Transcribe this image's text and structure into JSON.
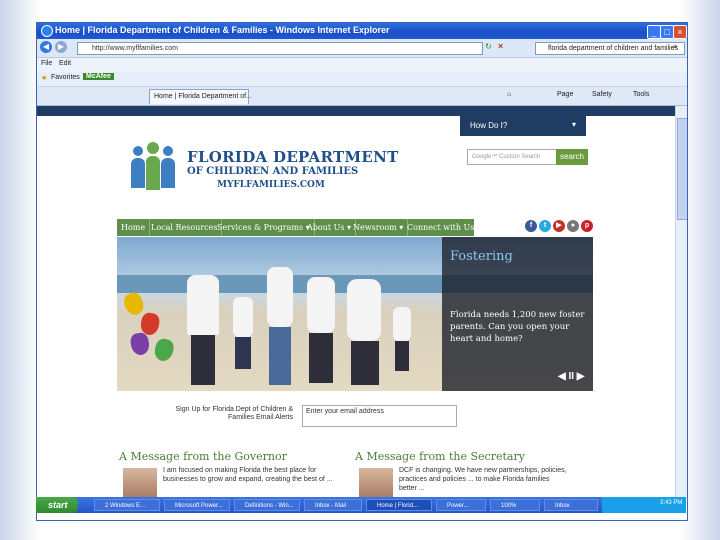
{
  "window": {
    "title": "Home | Florida Department of Children & Families - Windows Internet Explorer",
    "url": "http://www.myflfamilies.com",
    "search_text": "florida department of children and families"
  },
  "menubar": {
    "items": [
      "File",
      "Edit"
    ]
  },
  "favorites": {
    "label": "Favorites",
    "items": [
      "McAfee"
    ]
  },
  "tabs": [
    {
      "label": "Home | Florida Department of..."
    }
  ],
  "command_bar": [
    "Page",
    "Safety",
    "Tools"
  ],
  "site": {
    "help_label": "How Do I?",
    "logo_line1": "FLORIDA DEPARTMENT",
    "logo_line2": "OF CHILDREN AND FAMILIES",
    "logo_line3": "MYFLFAMILIES.COM",
    "search_placeholder": "Google™ Custom Search",
    "search_button": "search",
    "nav": [
      "Home",
      "Local Resources",
      "Services & Programs ▾",
      "About Us ▾",
      "Newsroom ▾",
      "Connect with Us"
    ],
    "social": [
      {
        "icon": "facebook-icon",
        "glyph": "f",
        "color": "#3b5998"
      },
      {
        "icon": "twitter-icon",
        "glyph": "t",
        "color": "#2aa9e0"
      },
      {
        "icon": "youtube-icon",
        "glyph": "▶",
        "color": "#c4302b"
      },
      {
        "icon": "flickr-icon",
        "glyph": "●",
        "color": "#777777"
      },
      {
        "icon": "pinterest-icon",
        "glyph": "p",
        "color": "#cb2027"
      }
    ],
    "hero": {
      "title": "Fostering",
      "text": "Florida needs 1,200 new foster parents. Can you open your heart and home?",
      "controls": "◀ II ▶"
    },
    "email_label": "Sign Up for Florida Dept of Children & Families Email Alerts",
    "email_placeholder": "Enter your email address",
    "governor_title": "A Message from the Governor",
    "governor_text": "I am focused on making Florida the best place for businesses to grow and expand, creating the best of ...",
    "secretary_title": "A Message from the Secretary",
    "secretary_text": "DCF is changing. We have new partnerships, policies, practices and policies ... to make Florida families better ..."
  },
  "taskbar": {
    "start_label": "start",
    "tasks": [
      "2 Windows E...",
      "Microsoft Power...",
      "Definitions - Win...",
      "Inbox - Mail",
      "Home | Florid...",
      "Power...",
      "100%",
      "Inbox"
    ],
    "clock": "3:43 PM"
  }
}
